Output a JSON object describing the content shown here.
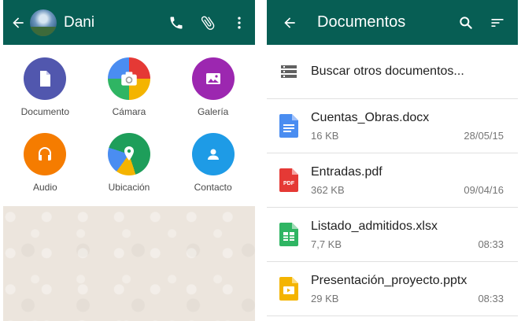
{
  "chat": {
    "contact_name": "Dani",
    "attach_options": [
      {
        "label": "Documento",
        "color": "#5157ae",
        "icon": "document-icon"
      },
      {
        "label": "Cámara",
        "color": "#e53935",
        "icon": "camera-icon"
      },
      {
        "label": "Galería",
        "color": "#9c27b0",
        "icon": "gallery-icon"
      },
      {
        "label": "Audio",
        "color": "#f57c00",
        "icon": "headphones-icon"
      },
      {
        "label": "Ubicación",
        "color": "#1e9e5a",
        "icon": "location-icon"
      },
      {
        "label": "Contacto",
        "color": "#1e9be6",
        "icon": "contact-icon"
      }
    ]
  },
  "documents": {
    "title": "Documentos",
    "search_label": "Buscar otros documentos...",
    "files": [
      {
        "name": "Cuentas_Obras.docx",
        "size": "16 KB",
        "date": "28/05/15",
        "type": "doc",
        "color": "#4a8df1"
      },
      {
        "name": "Entradas.pdf",
        "size": "362 KB",
        "date": "09/04/16",
        "type": "pdf",
        "color": "#e53935"
      },
      {
        "name": "Listado_admitidos.xlsx",
        "size": "7,7 KB",
        "date": "08:33",
        "type": "xls",
        "color": "#2fb563"
      },
      {
        "name": "Presentación_proyecto.pptx",
        "size": "29 KB",
        "date": "08:33",
        "type": "ppt",
        "color": "#f4b400"
      }
    ]
  }
}
